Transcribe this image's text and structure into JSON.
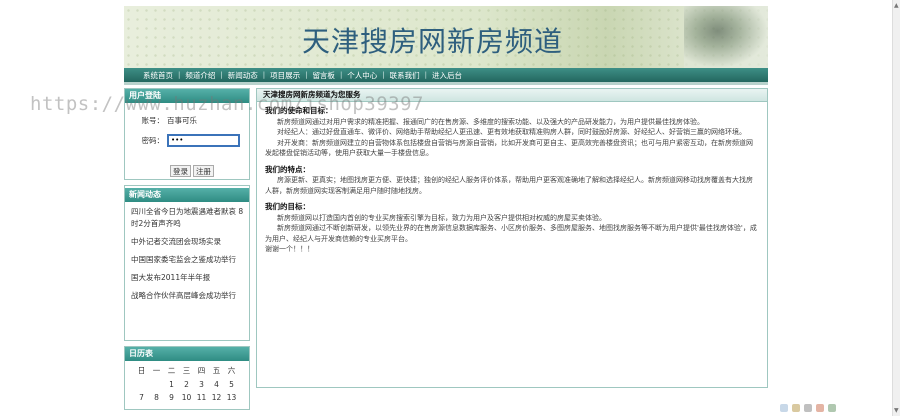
{
  "banner": {
    "title": "天津搜房网新房频道"
  },
  "nav": {
    "items": [
      "系统首页",
      "频道介绍",
      "新闻动态",
      "项目展示",
      "留言板",
      "个人中心",
      "联系我们",
      "进入后台"
    ],
    "separator": "|"
  },
  "login": {
    "header": "用户登陆",
    "username_label": "账号：",
    "username_value": "百事可乐",
    "password_label": "密码：",
    "password_value": "•••",
    "register_button": "注册",
    "login_button": "登录"
  },
  "news": {
    "header": "新闻动态",
    "items": [
      "四川全省今日为地震遇难者默哀 8时2分首声齐鸣",
      "中外记者交流团会现场实录",
      "中国国家委宅监会之鉴成功举行",
      "国大发布2011年半年报",
      "战略合作伙伴高层峰会成功举行"
    ]
  },
  "calendar": {
    "header": "日历表",
    "weekdays": [
      "日",
      "一",
      "二",
      "三",
      "四",
      "五",
      "六"
    ],
    "rows": [
      [
        "",
        "",
        "1",
        "2",
        "3",
        "4",
        "5",
        "6"
      ],
      [
        "7",
        "8",
        "9",
        "10",
        "11",
        "12",
        "13"
      ]
    ]
  },
  "main": {
    "header": "天津搜房网新房频道为您服务",
    "sections": [
      {
        "title": "我们的使命和目标：",
        "paragraphs": [
          "新房频道网通过对用户需求的精准把握、报通同广的在售房源、多维度的搜索功能、以及强大的产品研发能力，为用户提供最佳找房体验。",
          "对经纪人：通过好盘直通车、微评价、网络助手帮助经纪人更迅速、更有效地获取精准购房人群，同时鼓励好房源、好经纪人、好营销三赢的网络环境。",
          "对开发商：新房频道网建立的自营物体系包括楼盘自营销与房源自营销，比如开发商可更自主、更高效完善楼盘资讯；也可与用户紧密互动，在新房频道网发起楼盘促销活动等，使用户获取大量一手楼盘信息。"
        ]
      },
      {
        "title": "我们的特点：",
        "paragraphs": [
          "房源更新、更真实；地图找房更方便、更快捷；独创的经纪人服务评价体系，帮助用户更客观准确地了解和选择经纪人。新房频道网移动找房覆盖有大找房人群，新房频道网实现客制满足用户随时随地找房。"
        ]
      },
      {
        "title": "我们的目标：",
        "paragraphs": [
          "新房频道网以打造国内首创的专业买房搜索引擎为目标，致力为用户及客户提供相对权威的房屋买卖体验。",
          "新房频道网通过不断创新研发，以领先业界的在售房源信息数据库服务、小区房价服务、多图房屋服务、地图找房服务等不断为用户提供'最佳找房体验'，成为用户、经纪人与开发商信赖的专业买房平台。",
          "谢谢一个！！！"
        ]
      }
    ]
  },
  "watermark": "https://www.huzhan.com/ishop39397"
}
